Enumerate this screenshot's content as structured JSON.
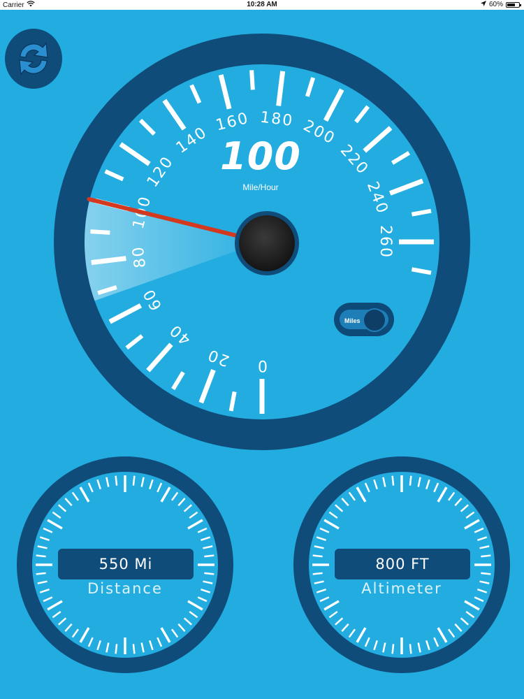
{
  "status_bar": {
    "carrier": "Carrier",
    "time": "10:28 AM",
    "battery": "60%"
  },
  "speedometer": {
    "speed_value": "100",
    "unit": "Mile/Hour",
    "scale_labels": [
      "0",
      "20",
      "40",
      "60",
      "80",
      "100",
      "120",
      "140",
      "160",
      "180",
      "200",
      "220",
      "240",
      "260"
    ],
    "min": 0,
    "max": 260,
    "needle_value": 100
  },
  "unit_toggle": {
    "label": "Miles"
  },
  "distance_gauge": {
    "value": "550 Mi",
    "label": "Distance"
  },
  "altimeter_gauge": {
    "value": "800 FT",
    "label": "Altimeter"
  },
  "colors": {
    "background": "#22ACE0",
    "gauge_rim": "#0F4C7A",
    "needle": "#D2391F",
    "tick": "#FFFFFF"
  },
  "icons": {
    "refresh": "refresh-icon",
    "wifi": "wifi-icon",
    "location": "location-arrow-icon",
    "battery": "battery-icon"
  }
}
